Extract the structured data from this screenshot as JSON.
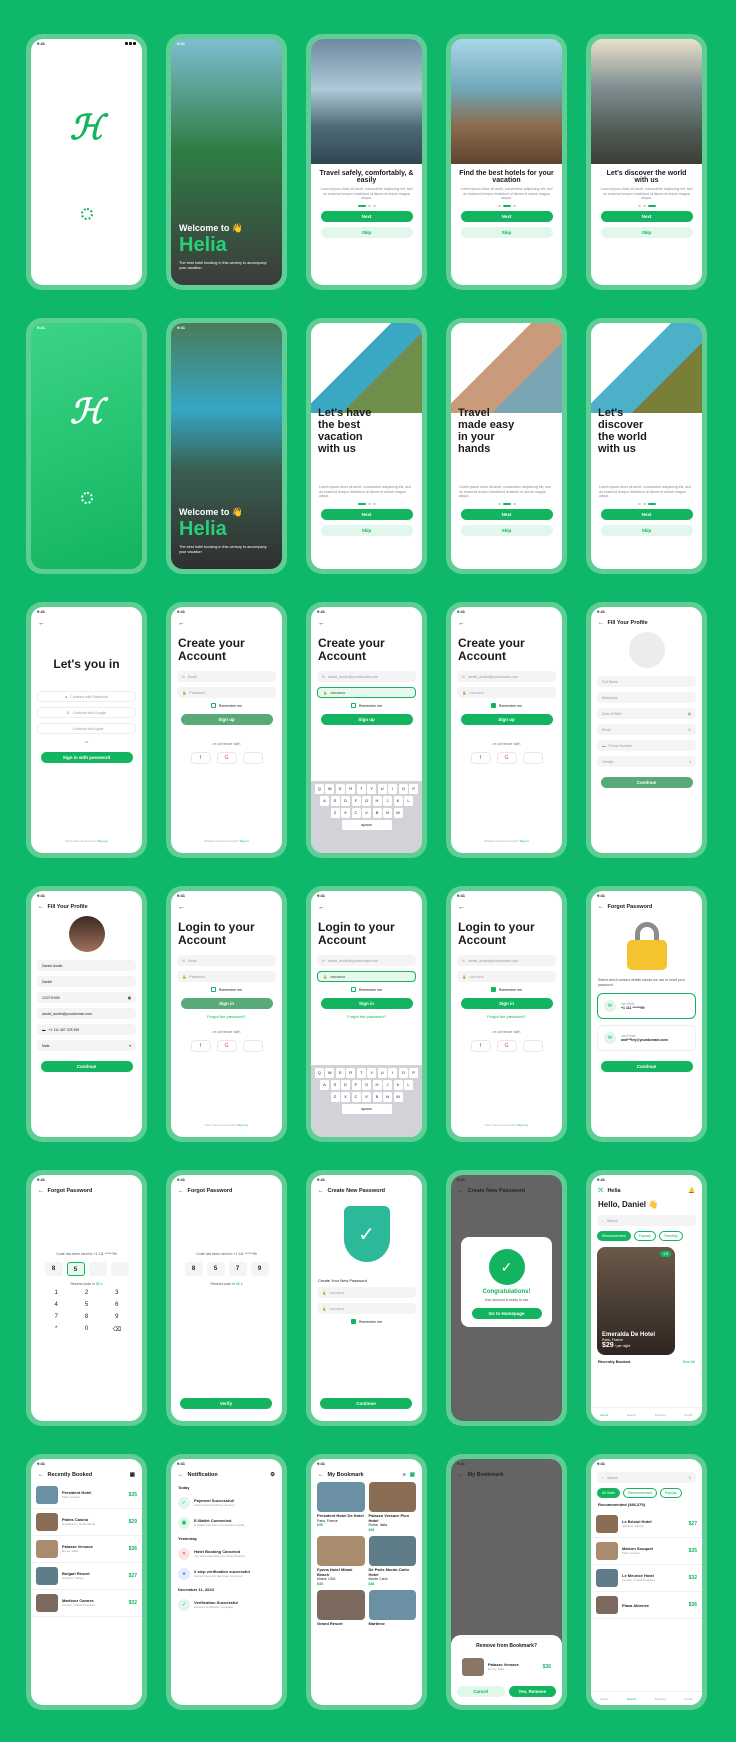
{
  "status_time": "9:41",
  "brand": "Helia",
  "welcome": {
    "heading": "Welcome to",
    "subtitle": "The best hotel booking in this century to accompany your vacation"
  },
  "onboarding1": [
    {
      "title": "Travel safely, comfortably, & easily"
    },
    {
      "title": "Find the best hotels for your vacation"
    },
    {
      "title": "Let's discover the world with us"
    }
  ],
  "onboarding2": [
    {
      "title": "Let's have the best vacation with us"
    },
    {
      "title": "Travel made easy in your hands"
    },
    {
      "title": "Let's discover the world with us"
    }
  ],
  "lorem": "Lorem ipsum dolor sit amet, consectetur adipiscing elit, sed do eiusmod tempor incididunt ut labore et dolore magna aliqua.",
  "buttons": {
    "next": "Next",
    "skip": "Skip",
    "sign_up": "Sign up",
    "sign_in": "Sign in",
    "sign_in_password": "Sign in with password",
    "continue": "Continue",
    "verify": "Verify",
    "go_home": "Go to Homepage",
    "cancel": "Cancel",
    "yes_remove": "Yes, Remove"
  },
  "lets_you_in": {
    "title": "Let's you in",
    "facebook": "Continue with Facebook",
    "google": "Continue with Google",
    "apple": "Continue with Apple",
    "or": "or",
    "footer": "Don't have an account?",
    "footer_link": "Sign up"
  },
  "create_account": {
    "title": "Create your Account",
    "email_placeholder": "Email",
    "password_placeholder": "Password",
    "email_value": "daniel_austin@yourdomain.com",
    "remember": "Remember me",
    "or_continue": "or continue with",
    "footer": "Already have an account?",
    "footer_link": "Sign in"
  },
  "login": {
    "title": "Login to your Account",
    "forgot": "Forgot the password?",
    "footer": "Don't have an account?",
    "footer_link": "Sign up"
  },
  "fill_profile": {
    "title": "Fill Your Profile",
    "full_name": "Full Name",
    "nickname": "Nickname",
    "dob": "Date of Birth",
    "email": "Email",
    "phone": "Phone Number",
    "gender": "Gender",
    "name_value": "Daniel Austin",
    "nick_value": "Daniel",
    "dob_value": "12/27/1995",
    "email_value": "daniel_austin@yourdomain.com",
    "phone_value": "+1 111 467 378 399",
    "gender_value": "Male"
  },
  "forgot": {
    "title": "Forgot Password",
    "desc": "Select which contact details should we use to reset your password",
    "via_sms": "via SMS:",
    "sms_value": "+1 111 ******99",
    "via_email": "via Email:",
    "email_value": "and***ley@yourdomain.com",
    "code_sent": "Code has been send to +1 111 ******99",
    "resend": "Resend code in",
    "resend_time": "55 s",
    "digits": [
      "8",
      "5",
      "7",
      "9"
    ]
  },
  "keypad": [
    "1",
    "2",
    "3",
    "4",
    "5",
    "6",
    "7",
    "8",
    "9",
    "*",
    "0",
    "⌫"
  ],
  "keyboard": [
    [
      "Q",
      "W",
      "E",
      "R",
      "T",
      "Y",
      "U",
      "I",
      "O",
      "P"
    ],
    [
      "A",
      "S",
      "D",
      "F",
      "G",
      "H",
      "J",
      "K",
      "L"
    ],
    [
      "Z",
      "X",
      "C",
      "V",
      "B",
      "N",
      "M"
    ]
  ],
  "keyboard_space": "space",
  "new_password": {
    "title": "Create New Password",
    "label": "Create Your New Password",
    "mask": "••••••••••••",
    "congrats": "Congratulations!",
    "congrats_sub": "Your account is ready to use"
  },
  "home": {
    "greeting": "Hello, Daniel",
    "search": "Search",
    "chips": [
      "Recommended",
      "Popular",
      "Trending"
    ],
    "featured_name": "Emeralda De Hotel",
    "featured_place": "Paris, France",
    "featured_price": "$29",
    "featured_unit": "/ per night",
    "rating": "4.8",
    "recently": "Recently Booked",
    "see_all": "See All"
  },
  "nav": [
    "Home",
    "Search",
    "Booking",
    "Profile"
  ],
  "recent": {
    "title": "Recently Booked",
    "items": [
      {
        "name": "President Hotel",
        "place": "Paris, France",
        "price": "$35"
      },
      {
        "name": "Palms Casino",
        "place": "Amsterdam, Netherlands",
        "price": "$29"
      },
      {
        "name": "Palazzo Versace",
        "place": "Rome, Italia",
        "price": "$36"
      },
      {
        "name": "Bulgari Resort",
        "place": "Istanbul, Turkiye",
        "price": "$27"
      },
      {
        "name": "Martinez Cannes",
        "place": "London, United Kingdom",
        "price": "$32"
      }
    ]
  },
  "notification": {
    "title": "Notification",
    "today": "Today",
    "yesterday": "Yesterday",
    "date": "December 11, 2024",
    "items": [
      {
        "title": "Payment Successful!",
        "sub": "Laluna Hotel booking payment"
      },
      {
        "title": "E-Wallet Connected",
        "sub": "E-Wallet has been connected to Helia"
      },
      {
        "title": "Hotel Booking Canceled",
        "sub": "You have canceled your hotel booking"
      },
      {
        "title": "2 step verification successful",
        "sub": "Account security has been improved"
      },
      {
        "title": "Verification Successful",
        "sub": "Account verification complete"
      }
    ]
  },
  "bookmark": {
    "title": "My Bookmark",
    "items": [
      {
        "name": "President Hotel De Hotel",
        "place": "Paris, France",
        "price": "$35"
      },
      {
        "name": "Palazzo Versace Pico Hotel",
        "place": "Rome, Italia",
        "price": "$36"
      },
      {
        "name": "Fpena Hotel Miami Beach",
        "place": "Miami, USA",
        "price": "$38"
      },
      {
        "name": "De Paris Monte-Carlo Hotel",
        "place": "Monte Carlo",
        "price": "$36"
      },
      {
        "name": "Grand Resort",
        "place": "",
        "price": ""
      },
      {
        "name": "Martinez",
        "place": "",
        "price": ""
      }
    ],
    "remove_title": "Remove from Bookmark?",
    "remove_item": "Palazzo Versace",
    "remove_place": "Rome, Italia",
    "remove_price": "$36"
  },
  "search_screen": {
    "search": "Search",
    "chips": [
      "All Hotel",
      "Recommended",
      "Popular"
    ],
    "count": "Recommended (386,379)",
    "items": [
      {
        "name": "Le Bristol Hotel",
        "place": "Istanbul, Turkiye",
        "price": "$27"
      },
      {
        "name": "Maison Souquet",
        "place": "Paris, France",
        "price": "$35"
      },
      {
        "name": "Le Meurice Hotel",
        "place": "London, United Kingdom",
        "price": "$32"
      },
      {
        "name": "Plaza Athenee",
        "place": "",
        "price": "$36"
      }
    ]
  },
  "colors": {
    "primary": "#12b45f",
    "background": "#0fb76b"
  }
}
